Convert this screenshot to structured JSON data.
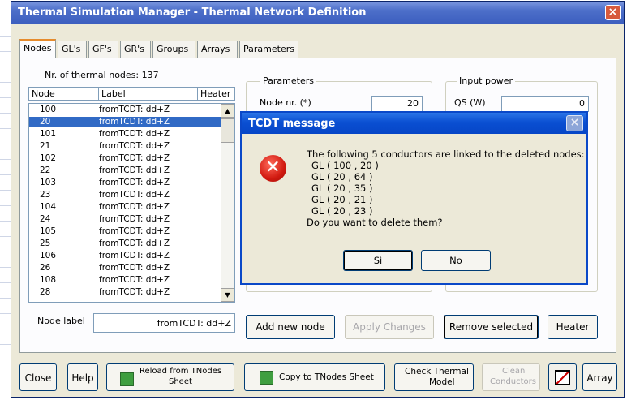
{
  "window": {
    "title": "Thermal Simulation Manager - Thermal Network Definition",
    "close_glyph": "×"
  },
  "tabs": [
    {
      "label": "Nodes"
    },
    {
      "label": "GL's"
    },
    {
      "label": "GF's"
    },
    {
      "label": "GR's"
    },
    {
      "label": "Groups"
    },
    {
      "label": "Arrays"
    },
    {
      "label": "Parameters"
    }
  ],
  "nodes_panel": {
    "count_text": "Nr. of thermal nodes:  137",
    "columns": [
      "Node",
      "Label",
      "Heater"
    ],
    "rows": [
      {
        "node": "100",
        "label": "fromTCDT: dd+Z"
      },
      {
        "node": "20",
        "label": "fromTCDT: dd+Z"
      },
      {
        "node": "101",
        "label": "fromTCDT: dd+Z"
      },
      {
        "node": "21",
        "label": "fromTCDT: dd+Z"
      },
      {
        "node": "102",
        "label": "fromTCDT: dd+Z"
      },
      {
        "node": "22",
        "label": "fromTCDT: dd+Z"
      },
      {
        "node": "103",
        "label": "fromTCDT: dd+Z"
      },
      {
        "node": "23",
        "label": "fromTCDT: dd+Z"
      },
      {
        "node": "104",
        "label": "fromTCDT: dd+Z"
      },
      {
        "node": "24",
        "label": "fromTCDT: dd+Z"
      },
      {
        "node": "105",
        "label": "fromTCDT: dd+Z"
      },
      {
        "node": "25",
        "label": "fromTCDT: dd+Z"
      },
      {
        "node": "106",
        "label": "fromTCDT: dd+Z"
      },
      {
        "node": "26",
        "label": "fromTCDT: dd+Z"
      },
      {
        "node": "108",
        "label": "fromTCDT: dd+Z"
      },
      {
        "node": "28",
        "label": "fromTCDT: dd+Z"
      }
    ],
    "selected_index": 1,
    "node_label_caption": "Node label",
    "node_label_value": "fromTCDT: dd+Z"
  },
  "parameters_group": {
    "title": "Parameters",
    "node_nr_label": "Node nr. (*)",
    "node_nr_value": "20"
  },
  "input_power_group": {
    "title": "Input power",
    "qs_label": "QS (W)",
    "qs_value": "0"
  },
  "action_buttons": {
    "add_new_node": "Add new node",
    "apply_changes": "Apply Changes",
    "remove_selected": "Remove selected",
    "heater": "Heater"
  },
  "bottom_buttons": {
    "close": "Close",
    "help": "Help",
    "reload_line1": "Reload from TNodes",
    "reload_line2": "Sheet",
    "copy": "Copy to TNodes Sheet",
    "check_line1": "Check Thermal",
    "check_line2": "Model",
    "clean_line1": "Clean",
    "clean_line2": "Conductors",
    "array": "Array"
  },
  "dialog": {
    "title": "TCDT message",
    "close_glyph": "×",
    "icon_glyph": "✕",
    "lines": [
      "The following 5 conductors are linked to the deleted nodes:",
      "GL ( 100 , 20 )",
      "GL ( 20 , 64 )",
      "GL ( 20 , 35 )",
      "GL ( 20 , 21 )",
      "GL ( 20 , 23 )",
      "Do you want to delete them?"
    ],
    "yes_label": "Sì",
    "no_label": "No"
  },
  "colors": {
    "selection": "#316ac5",
    "xp_title_blue": "#0a4fd2",
    "tab_highlight": "#e68b2c",
    "error_red": "#d11a10"
  }
}
